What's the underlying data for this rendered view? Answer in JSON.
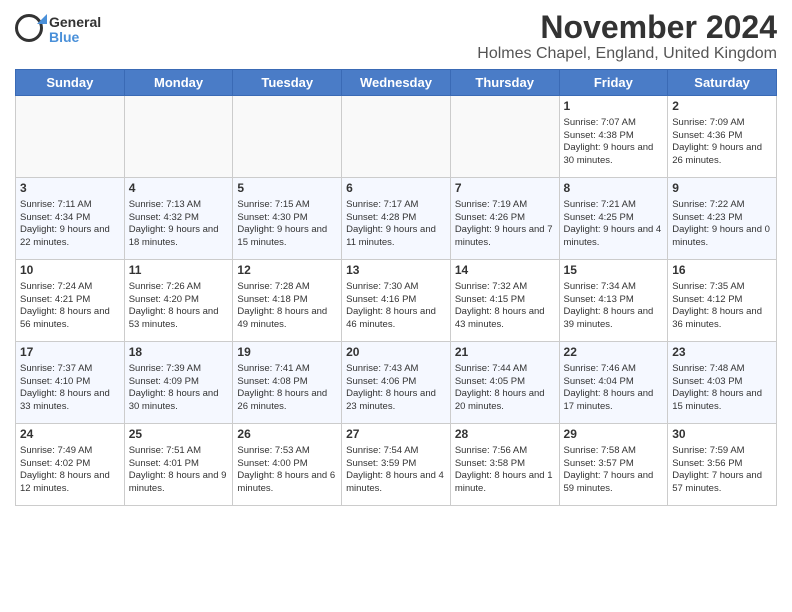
{
  "logo": {
    "text_general": "General",
    "text_blue": "Blue"
  },
  "header": {
    "month": "November 2024",
    "location": "Holmes Chapel, England, United Kingdom"
  },
  "weekdays": [
    "Sunday",
    "Monday",
    "Tuesday",
    "Wednesday",
    "Thursday",
    "Friday",
    "Saturday"
  ],
  "weeks": [
    [
      {
        "day": "",
        "info": ""
      },
      {
        "day": "",
        "info": ""
      },
      {
        "day": "",
        "info": ""
      },
      {
        "day": "",
        "info": ""
      },
      {
        "day": "",
        "info": ""
      },
      {
        "day": "1",
        "info": "Sunrise: 7:07 AM\nSunset: 4:38 PM\nDaylight: 9 hours and 30 minutes."
      },
      {
        "day": "2",
        "info": "Sunrise: 7:09 AM\nSunset: 4:36 PM\nDaylight: 9 hours and 26 minutes."
      }
    ],
    [
      {
        "day": "3",
        "info": "Sunrise: 7:11 AM\nSunset: 4:34 PM\nDaylight: 9 hours and 22 minutes."
      },
      {
        "day": "4",
        "info": "Sunrise: 7:13 AM\nSunset: 4:32 PM\nDaylight: 9 hours and 18 minutes."
      },
      {
        "day": "5",
        "info": "Sunrise: 7:15 AM\nSunset: 4:30 PM\nDaylight: 9 hours and 15 minutes."
      },
      {
        "day": "6",
        "info": "Sunrise: 7:17 AM\nSunset: 4:28 PM\nDaylight: 9 hours and 11 minutes."
      },
      {
        "day": "7",
        "info": "Sunrise: 7:19 AM\nSunset: 4:26 PM\nDaylight: 9 hours and 7 minutes."
      },
      {
        "day": "8",
        "info": "Sunrise: 7:21 AM\nSunset: 4:25 PM\nDaylight: 9 hours and 4 minutes."
      },
      {
        "day": "9",
        "info": "Sunrise: 7:22 AM\nSunset: 4:23 PM\nDaylight: 9 hours and 0 minutes."
      }
    ],
    [
      {
        "day": "10",
        "info": "Sunrise: 7:24 AM\nSunset: 4:21 PM\nDaylight: 8 hours and 56 minutes."
      },
      {
        "day": "11",
        "info": "Sunrise: 7:26 AM\nSunset: 4:20 PM\nDaylight: 8 hours and 53 minutes."
      },
      {
        "day": "12",
        "info": "Sunrise: 7:28 AM\nSunset: 4:18 PM\nDaylight: 8 hours and 49 minutes."
      },
      {
        "day": "13",
        "info": "Sunrise: 7:30 AM\nSunset: 4:16 PM\nDaylight: 8 hours and 46 minutes."
      },
      {
        "day": "14",
        "info": "Sunrise: 7:32 AM\nSunset: 4:15 PM\nDaylight: 8 hours and 43 minutes."
      },
      {
        "day": "15",
        "info": "Sunrise: 7:34 AM\nSunset: 4:13 PM\nDaylight: 8 hours and 39 minutes."
      },
      {
        "day": "16",
        "info": "Sunrise: 7:35 AM\nSunset: 4:12 PM\nDaylight: 8 hours and 36 minutes."
      }
    ],
    [
      {
        "day": "17",
        "info": "Sunrise: 7:37 AM\nSunset: 4:10 PM\nDaylight: 8 hours and 33 minutes."
      },
      {
        "day": "18",
        "info": "Sunrise: 7:39 AM\nSunset: 4:09 PM\nDaylight: 8 hours and 30 minutes."
      },
      {
        "day": "19",
        "info": "Sunrise: 7:41 AM\nSunset: 4:08 PM\nDaylight: 8 hours and 26 minutes."
      },
      {
        "day": "20",
        "info": "Sunrise: 7:43 AM\nSunset: 4:06 PM\nDaylight: 8 hours and 23 minutes."
      },
      {
        "day": "21",
        "info": "Sunrise: 7:44 AM\nSunset: 4:05 PM\nDaylight: 8 hours and 20 minutes."
      },
      {
        "day": "22",
        "info": "Sunrise: 7:46 AM\nSunset: 4:04 PM\nDaylight: 8 hours and 17 minutes."
      },
      {
        "day": "23",
        "info": "Sunrise: 7:48 AM\nSunset: 4:03 PM\nDaylight: 8 hours and 15 minutes."
      }
    ],
    [
      {
        "day": "24",
        "info": "Sunrise: 7:49 AM\nSunset: 4:02 PM\nDaylight: 8 hours and 12 minutes."
      },
      {
        "day": "25",
        "info": "Sunrise: 7:51 AM\nSunset: 4:01 PM\nDaylight: 8 hours and 9 minutes."
      },
      {
        "day": "26",
        "info": "Sunrise: 7:53 AM\nSunset: 4:00 PM\nDaylight: 8 hours and 6 minutes."
      },
      {
        "day": "27",
        "info": "Sunrise: 7:54 AM\nSunset: 3:59 PM\nDaylight: 8 hours and 4 minutes."
      },
      {
        "day": "28",
        "info": "Sunrise: 7:56 AM\nSunset: 3:58 PM\nDaylight: 8 hours and 1 minute."
      },
      {
        "day": "29",
        "info": "Sunrise: 7:58 AM\nSunset: 3:57 PM\nDaylight: 7 hours and 59 minutes."
      },
      {
        "day": "30",
        "info": "Sunrise: 7:59 AM\nSunset: 3:56 PM\nDaylight: 7 hours and 57 minutes."
      }
    ]
  ]
}
